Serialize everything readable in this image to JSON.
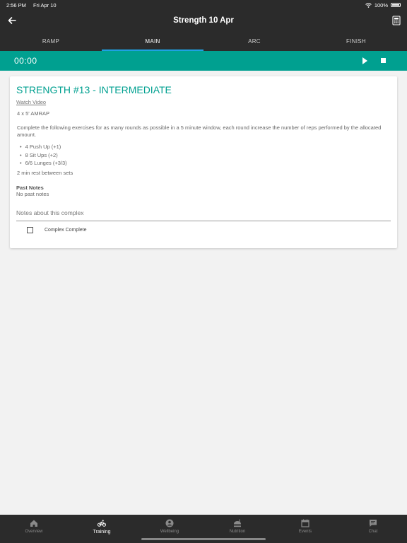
{
  "status_bar": {
    "time": "2:56 PM",
    "date": "Fri Apr 10",
    "battery": "100%"
  },
  "header": {
    "title": "Strength 10 Apr",
    "back_icon": "arrow-left-icon",
    "right_icon": "calculator-icon"
  },
  "tabs": [
    {
      "label": "RAMP",
      "active": false
    },
    {
      "label": "MAIN",
      "active": true
    },
    {
      "label": "ARC",
      "active": false
    },
    {
      "label": "FINISH",
      "active": false
    }
  ],
  "timer": {
    "value": "00:00",
    "play_icon": "play-icon",
    "stop_icon": "stop-icon"
  },
  "card": {
    "title": "STRENGTH #13 - INTERMEDIATE",
    "video_link": "Watch Video",
    "scheme": "4 x 5' AMRAP",
    "description": "Complete the following exercises for as many rounds as possible in a 5 minute window, each round increase the number of reps performed by the allocated amount.",
    "exercises": [
      "4 Push Up (+1)",
      "8 Sit Ups (+2)",
      "6/6 Lunges (+3/3)"
    ],
    "rest": "2 min rest between sets",
    "past_notes_title": "Past Notes",
    "past_notes_value": "No past notes",
    "notes_placeholder": "Notes about this complex",
    "complete_label": "Complex Complete",
    "complete_checked": false
  },
  "bottom_nav": [
    {
      "label": "Overview",
      "icon": "home-icon",
      "active": false
    },
    {
      "label": "Training",
      "icon": "bicycle-icon",
      "active": true
    },
    {
      "label": "Wellbeing",
      "icon": "user-circle-icon",
      "active": false
    },
    {
      "label": "Nutrition",
      "icon": "food-icon",
      "active": false
    },
    {
      "label": "Events",
      "icon": "calendar-icon",
      "active": false
    },
    {
      "label": "Chat",
      "icon": "chat-icon",
      "active": false
    }
  ],
  "colors": {
    "accent": "#00a090",
    "bar_bg": "#2b2b2b",
    "tab_indicator": "#1fa0e3",
    "page_bg": "#f2f2f2"
  }
}
